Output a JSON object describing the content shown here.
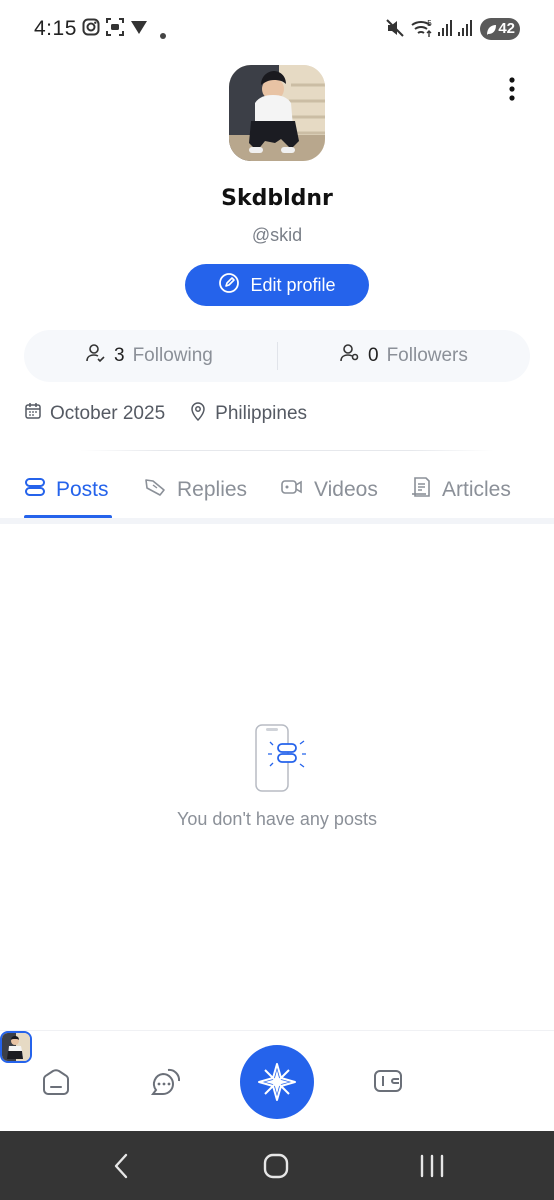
{
  "status_bar": {
    "time": "4:15",
    "battery_level": "42",
    "icons": [
      "instagram-icon",
      "screen-record-icon",
      "vpn-icon",
      "dot-icon",
      "mute-icon",
      "wifi-icon",
      "signal-icon",
      "signal-icon-2",
      "battery-icon"
    ]
  },
  "profile": {
    "display_name": "Skdbldnr",
    "handle": "@skid",
    "edit_label": "Edit profile",
    "following_count": "3",
    "following_label": "Following",
    "followers_count": "0",
    "followers_label": "Followers",
    "joined": "October 2025",
    "location": "Philippines"
  },
  "tabs": [
    {
      "label": "Posts",
      "icon": "posts-icon",
      "active": true
    },
    {
      "label": "Replies",
      "icon": "replies-icon",
      "active": false
    },
    {
      "label": "Videos",
      "icon": "video-icon",
      "active": false
    },
    {
      "label": "Articles",
      "icon": "article-icon",
      "active": false
    }
  ],
  "empty_state": {
    "message": "You don't have any posts"
  },
  "bottom_nav": [
    "home-icon",
    "chat-icon",
    "compose-star-icon",
    "wallet-icon",
    "profile-avatar"
  ],
  "colors": {
    "accent": "#2563eb",
    "muted_text": "#8b9098",
    "card_bg": "#f6f8fb",
    "system_nav_bg": "#353535"
  }
}
